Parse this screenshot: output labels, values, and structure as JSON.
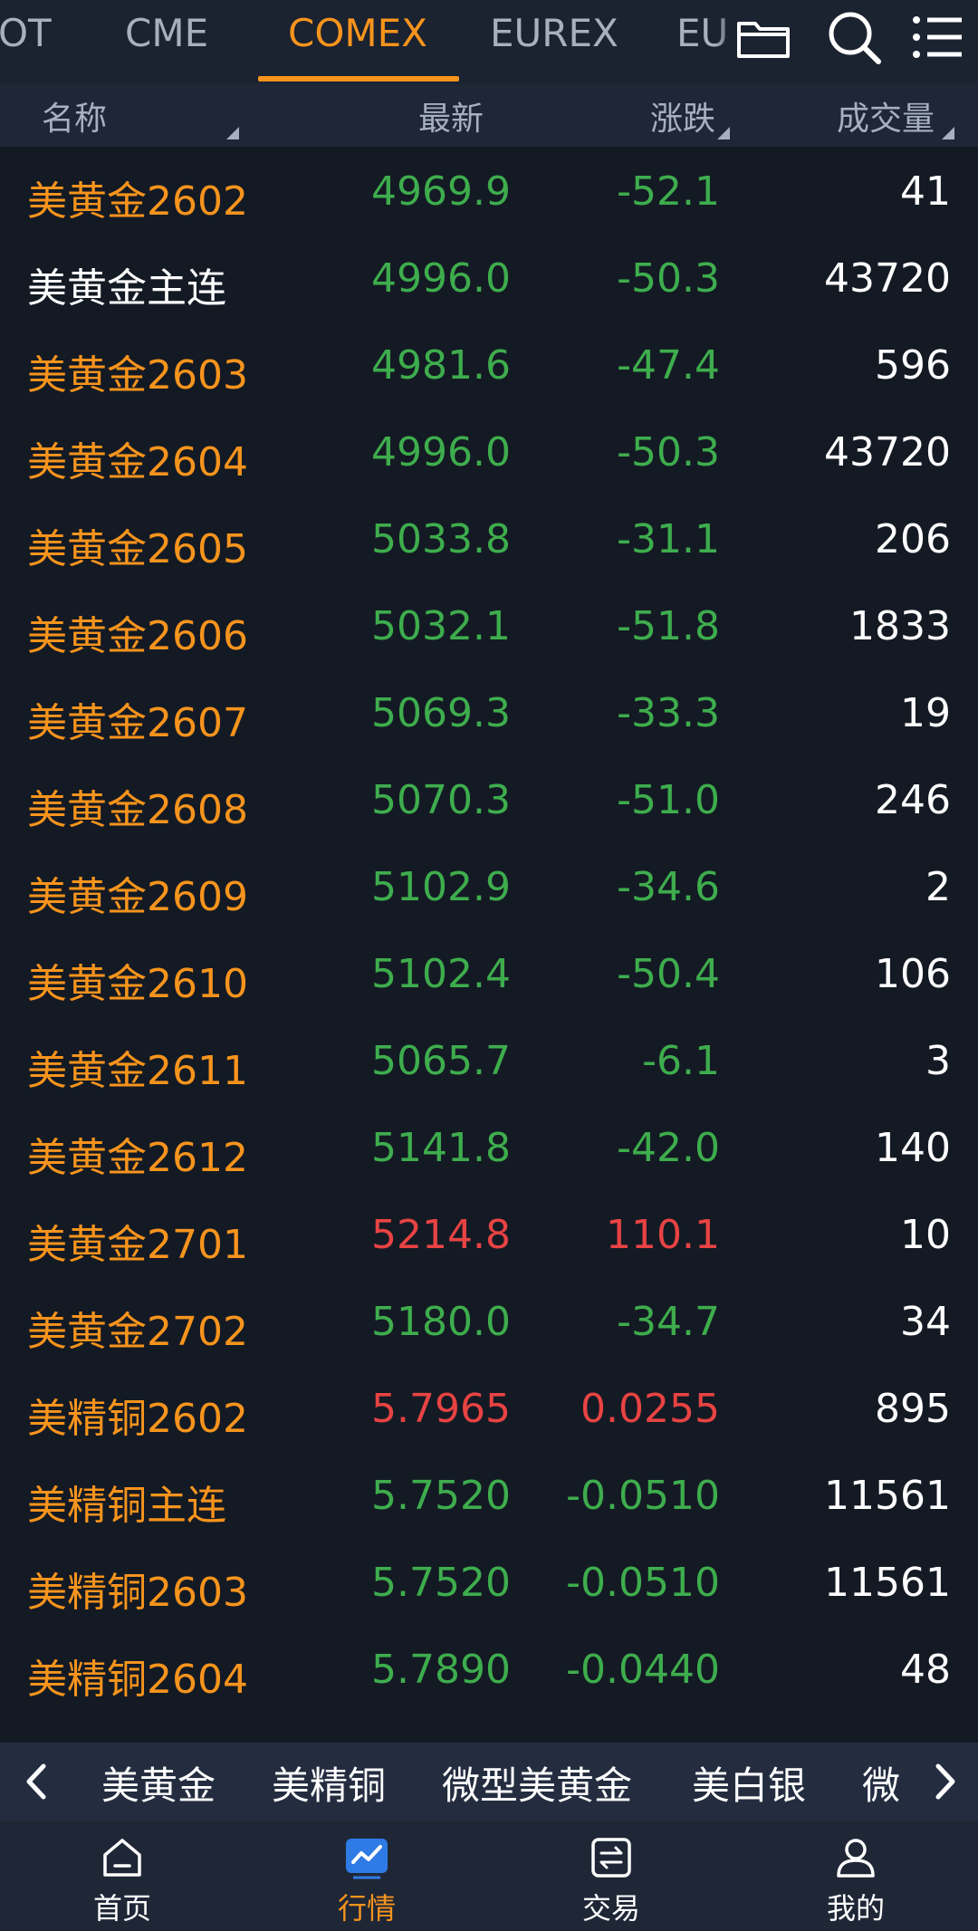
{
  "tabs": [
    {
      "label": "OT",
      "active": false
    },
    {
      "label": "CME",
      "active": false
    },
    {
      "label": "COMEX",
      "active": true
    },
    {
      "label": "EUREX",
      "active": false
    },
    {
      "label": "EU",
      "active": false
    }
  ],
  "top_icons": [
    "folder-icon",
    "search-icon",
    "menu-list-icon"
  ],
  "columns": {
    "name": "名称",
    "latest": "最新",
    "change": "涨跌",
    "volume": "成交量"
  },
  "rows": [
    {
      "name": "美黄金2602",
      "price": "4969.9",
      "change": "-52.1",
      "volume": "41",
      "name_color": "orange",
      "dir": "down"
    },
    {
      "name": "美黄金主连",
      "price": "4996.0",
      "change": "-50.3",
      "volume": "43720",
      "name_color": "white",
      "dir": "down"
    },
    {
      "name": "美黄金2603",
      "price": "4981.6",
      "change": "-47.4",
      "volume": "596",
      "name_color": "orange",
      "dir": "down"
    },
    {
      "name": "美黄金2604",
      "price": "4996.0",
      "change": "-50.3",
      "volume": "43720",
      "name_color": "orange",
      "dir": "down"
    },
    {
      "name": "美黄金2605",
      "price": "5033.8",
      "change": "-31.1",
      "volume": "206",
      "name_color": "orange",
      "dir": "down"
    },
    {
      "name": "美黄金2606",
      "price": "5032.1",
      "change": "-51.8",
      "volume": "1833",
      "name_color": "orange",
      "dir": "down"
    },
    {
      "name": "美黄金2607",
      "price": "5069.3",
      "change": "-33.3",
      "volume": "19",
      "name_color": "orange",
      "dir": "down"
    },
    {
      "name": "美黄金2608",
      "price": "5070.3",
      "change": "-51.0",
      "volume": "246",
      "name_color": "orange",
      "dir": "down"
    },
    {
      "name": "美黄金2609",
      "price": "5102.9",
      "change": "-34.6",
      "volume": "2",
      "name_color": "orange",
      "dir": "down"
    },
    {
      "name": "美黄金2610",
      "price": "5102.4",
      "change": "-50.4",
      "volume": "106",
      "name_color": "orange",
      "dir": "down"
    },
    {
      "name": "美黄金2611",
      "price": "5065.7",
      "change": "-6.1",
      "volume": "3",
      "name_color": "orange",
      "dir": "down"
    },
    {
      "name": "美黄金2612",
      "price": "5141.8",
      "change": "-42.0",
      "volume": "140",
      "name_color": "orange",
      "dir": "down"
    },
    {
      "name": "美黄金2701",
      "price": "5214.8",
      "change": "110.1",
      "volume": "10",
      "name_color": "orange",
      "dir": "up"
    },
    {
      "name": "美黄金2702",
      "price": "5180.0",
      "change": "-34.7",
      "volume": "34",
      "name_color": "orange",
      "dir": "down"
    },
    {
      "name": "美精铜2602",
      "price": "5.7965",
      "change": "0.0255",
      "volume": "895",
      "name_color": "orange",
      "dir": "up"
    },
    {
      "name": "美精铜主连",
      "price": "5.7520",
      "change": "-0.0510",
      "volume": "11561",
      "name_color": "orange",
      "dir": "down"
    },
    {
      "name": "美精铜2603",
      "price": "5.7520",
      "change": "-0.0510",
      "volume": "11561",
      "name_color": "orange",
      "dir": "down"
    },
    {
      "name": "美精铜2604",
      "price": "5.7890",
      "change": "-0.0440",
      "volume": "48",
      "name_color": "orange",
      "dir": "down"
    }
  ],
  "categories": [
    "美黄金",
    "美精铜",
    "微型美黄金",
    "美白银",
    "微"
  ],
  "bottom_nav": [
    {
      "label": "首页",
      "icon": "home-icon",
      "active": false
    },
    {
      "label": "行情",
      "icon": "market-chart-icon",
      "active": true
    },
    {
      "label": "交易",
      "icon": "trade-exchange-icon",
      "active": false
    },
    {
      "label": "我的",
      "icon": "profile-icon",
      "active": false
    }
  ],
  "colors": {
    "accent": "#f7941d",
    "up": "#e84343",
    "down": "#3ead4d",
    "background": "#141a24"
  }
}
